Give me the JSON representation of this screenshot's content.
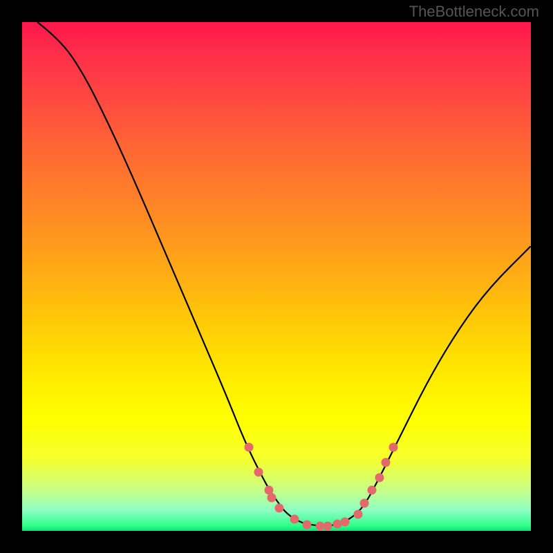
{
  "watermark": "TheBottleneck.com",
  "chart_data": {
    "type": "line",
    "title": "",
    "xlabel": "",
    "ylabel": "",
    "xlim": [
      0,
      1
    ],
    "ylim": [
      0,
      1
    ],
    "series": [
      {
        "name": "curve",
        "color": "#000000",
        "points": [
          {
            "x": 0.03,
            "y": 1.0
          },
          {
            "x": 0.075,
            "y": 0.965
          },
          {
            "x": 0.12,
            "y": 0.9
          },
          {
            "x": 0.17,
            "y": 0.8
          },
          {
            "x": 0.22,
            "y": 0.69
          },
          {
            "x": 0.28,
            "y": 0.55
          },
          {
            "x": 0.34,
            "y": 0.41
          },
          {
            "x": 0.4,
            "y": 0.27
          },
          {
            "x": 0.44,
            "y": 0.17
          },
          {
            "x": 0.48,
            "y": 0.09
          },
          {
            "x": 0.5,
            "y": 0.06
          },
          {
            "x": 0.52,
            "y": 0.033
          },
          {
            "x": 0.55,
            "y": 0.015
          },
          {
            "x": 0.58,
            "y": 0.01
          },
          {
            "x": 0.61,
            "y": 0.01
          },
          {
            "x": 0.64,
            "y": 0.02
          },
          {
            "x": 0.67,
            "y": 0.045
          },
          {
            "x": 0.7,
            "y": 0.1
          },
          {
            "x": 0.74,
            "y": 0.18
          },
          {
            "x": 0.8,
            "y": 0.3
          },
          {
            "x": 0.86,
            "y": 0.4
          },
          {
            "x": 0.92,
            "y": 0.48
          },
          {
            "x": 1.0,
            "y": 0.56
          }
        ]
      },
      {
        "name": "highlights",
        "color": "#e36a6a",
        "type": "scatter",
        "points": [
          {
            "x": 0.445,
            "y": 0.165
          },
          {
            "x": 0.465,
            "y": 0.115
          },
          {
            "x": 0.485,
            "y": 0.08
          },
          {
            "x": 0.49,
            "y": 0.065
          },
          {
            "x": 0.505,
            "y": 0.045
          },
          {
            "x": 0.535,
            "y": 0.023
          },
          {
            "x": 0.56,
            "y": 0.012
          },
          {
            "x": 0.585,
            "y": 0.01
          },
          {
            "x": 0.6,
            "y": 0.01
          },
          {
            "x": 0.62,
            "y": 0.013
          },
          {
            "x": 0.635,
            "y": 0.018
          },
          {
            "x": 0.66,
            "y": 0.033
          },
          {
            "x": 0.672,
            "y": 0.055
          },
          {
            "x": 0.688,
            "y": 0.08
          },
          {
            "x": 0.702,
            "y": 0.105
          },
          {
            "x": 0.715,
            "y": 0.135
          },
          {
            "x": 0.73,
            "y": 0.165
          }
        ]
      }
    ]
  }
}
